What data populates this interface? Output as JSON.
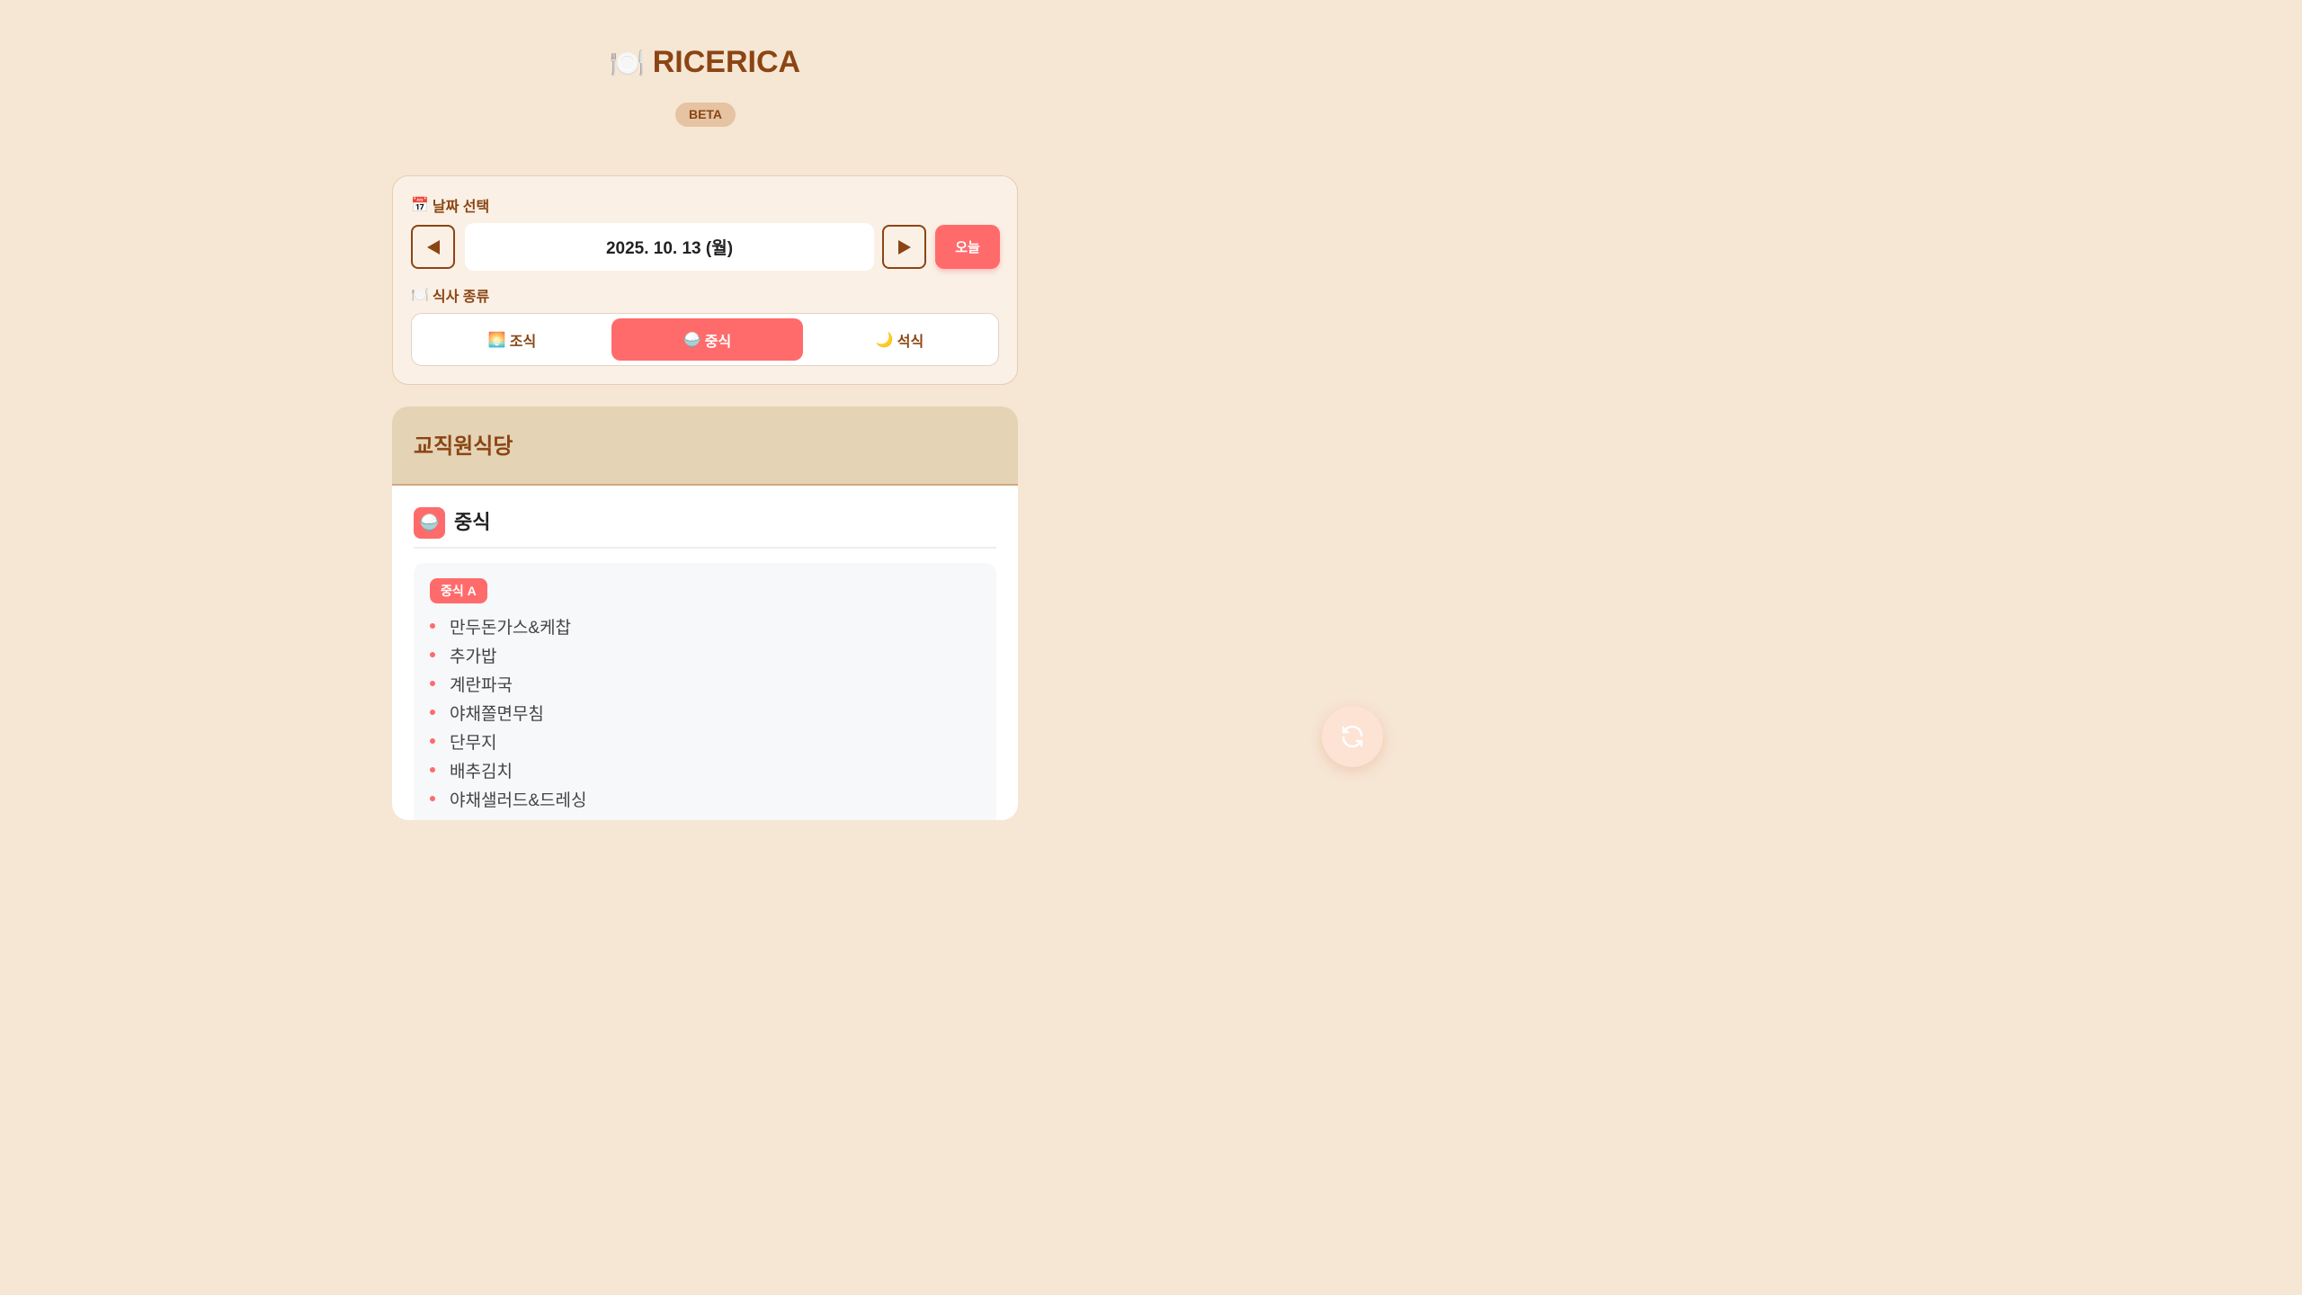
{
  "app": {
    "title": "RICERICA",
    "title_emoji": "🍽️",
    "badge": "BETA"
  },
  "date_section": {
    "label": "날짜 선택",
    "label_emoji": "📅",
    "prev_icon": "triangle-left-icon",
    "next_icon": "triangle-right-icon",
    "current_date": "2025. 10. 13 (월)",
    "today_label": "오늘"
  },
  "meal_section": {
    "label": "식사 종류",
    "label_emoji": "🍽️",
    "tabs": [
      {
        "emoji": "🌅",
        "label": "조식",
        "active": false
      },
      {
        "emoji": "🍚",
        "label": "중식",
        "active": true
      },
      {
        "emoji": "🌙",
        "label": "석식",
        "active": false
      }
    ]
  },
  "cafeteria": {
    "name": "교직원식당",
    "meal_emoji": "🍚",
    "meal_title": "중식",
    "course_label": "중식 A",
    "items": [
      "만두돈가스&케찹",
      "추가밥",
      "계란파국",
      "야채쫄면무침",
      "단무지",
      "배추김치",
      "야채샐러드&드레싱"
    ]
  },
  "fab": {
    "icon": "refresh-icon"
  },
  "colors": {
    "background": "#f6e6d4",
    "accent": "#ff6b6b",
    "brown": "#8b4513"
  }
}
